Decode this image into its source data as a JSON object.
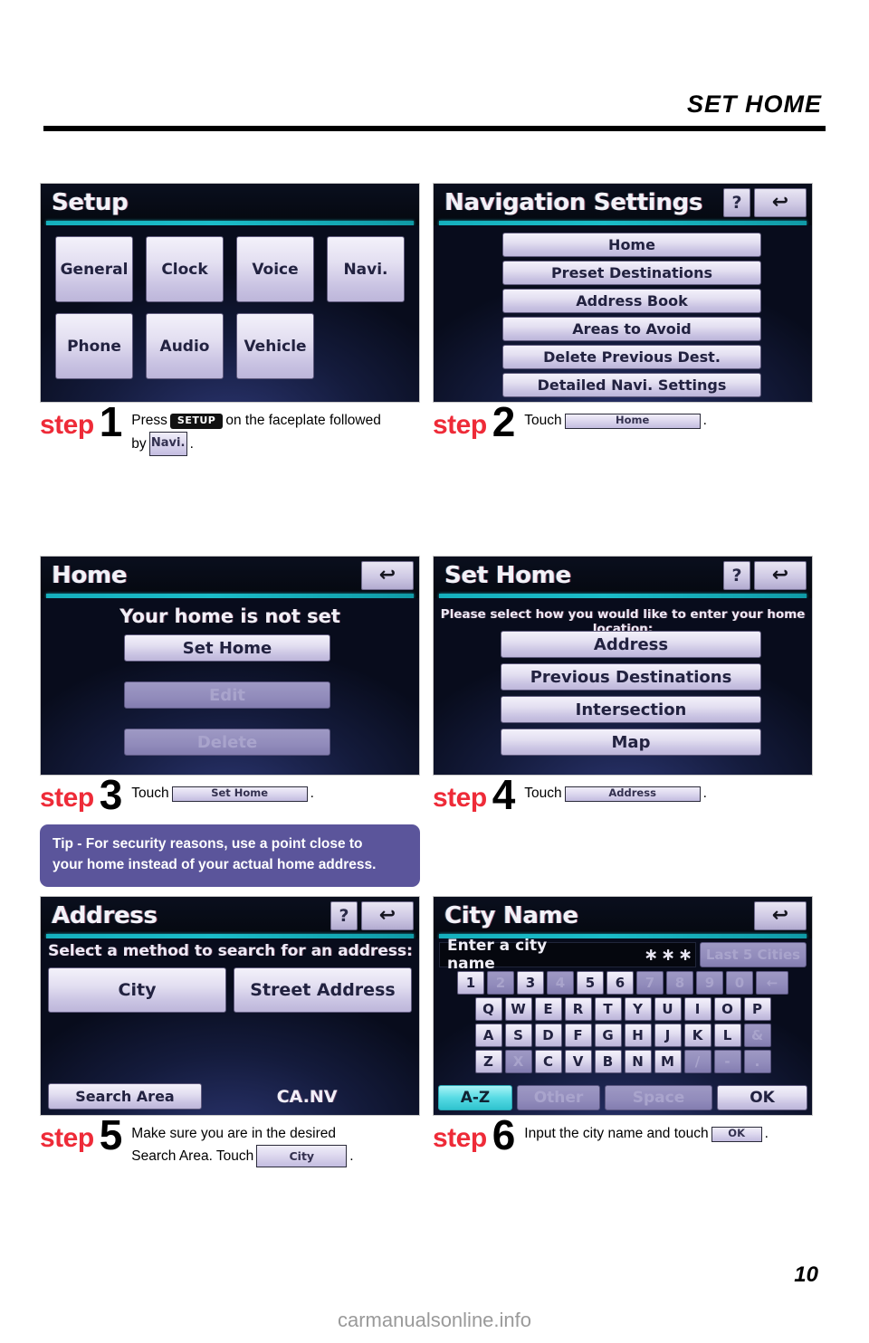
{
  "header": {
    "title": "SET HOME"
  },
  "footer": {
    "page_number": "10",
    "watermark": "carmanualsonline.info"
  },
  "tip": {
    "line1": "Tip - For security reasons, use a point close to",
    "line2": "your home instead of your actual home address."
  },
  "screens": {
    "setup": {
      "title": "Setup",
      "row1": [
        "General",
        "Clock",
        "Voice",
        "Navi."
      ],
      "row2": [
        "Phone",
        "Audio",
        "Vehicle"
      ]
    },
    "navigation_settings": {
      "title": "Navigation Settings",
      "help_label": "?",
      "back_label": "↩",
      "items": [
        "Home",
        "Preset Destinations",
        "Address Book",
        "Areas to Avoid",
        "Delete Previous Dest.",
        "Detailed Navi. Settings"
      ]
    },
    "home": {
      "title": "Home",
      "back_label": "↩",
      "message": "Your home is not set",
      "buttons": [
        {
          "label": "Set Home",
          "enabled": true
        },
        {
          "label": "Edit",
          "enabled": false
        },
        {
          "label": "Delete",
          "enabled": false
        }
      ]
    },
    "set_home": {
      "title": "Set Home",
      "help_label": "?",
      "back_label": "↩",
      "prompt": "Please select how you would like to enter your home location:",
      "items": [
        "Address",
        "Previous Destinations",
        "Intersection",
        "Map"
      ]
    },
    "address": {
      "title": "Address",
      "help_label": "?",
      "back_label": "↩",
      "prompt": "Select a method to search for an address:",
      "methods": [
        "City",
        "Street Address"
      ],
      "search_area_label": "Search Area",
      "search_area_value": "CA.NV"
    },
    "city_name": {
      "title": "City Name",
      "back_label": "↩",
      "input_placeholder": "Enter a city name",
      "input_stars": "∗∗∗",
      "last5_label": "Last 5 Cities",
      "rows": [
        [
          {
            "k": "1",
            "on": true
          },
          {
            "k": "2",
            "on": false
          },
          {
            "k": "3",
            "on": true
          },
          {
            "k": "4",
            "on": false
          },
          {
            "k": "5",
            "on": true
          },
          {
            "k": "6",
            "on": true
          },
          {
            "k": "7",
            "on": false
          },
          {
            "k": "8",
            "on": false
          },
          {
            "k": "9",
            "on": false
          },
          {
            "k": "0",
            "on": false
          },
          {
            "k": "←",
            "on": false,
            "wide": true
          }
        ],
        [
          {
            "k": "Q",
            "on": true
          },
          {
            "k": "W",
            "on": true
          },
          {
            "k": "E",
            "on": true
          },
          {
            "k": "R",
            "on": true
          },
          {
            "k": "T",
            "on": true
          },
          {
            "k": "Y",
            "on": true
          },
          {
            "k": "U",
            "on": true
          },
          {
            "k": "I",
            "on": true
          },
          {
            "k": "O",
            "on": true
          },
          {
            "k": "P",
            "on": true
          }
        ],
        [
          {
            "k": "A",
            "on": true
          },
          {
            "k": "S",
            "on": true
          },
          {
            "k": "D",
            "on": true
          },
          {
            "k": "F",
            "on": true
          },
          {
            "k": "G",
            "on": true
          },
          {
            "k": "H",
            "on": true
          },
          {
            "k": "J",
            "on": true
          },
          {
            "k": "K",
            "on": true
          },
          {
            "k": "L",
            "on": true
          },
          {
            "k": "&",
            "on": false
          }
        ],
        [
          {
            "k": "Z",
            "on": true
          },
          {
            "k": "X",
            "on": false
          },
          {
            "k": "C",
            "on": true
          },
          {
            "k": "V",
            "on": true
          },
          {
            "k": "B",
            "on": true
          },
          {
            "k": "N",
            "on": true
          },
          {
            "k": "M",
            "on": true
          },
          {
            "k": "/",
            "on": false
          },
          {
            "k": "-",
            "on": false
          },
          {
            "k": ".",
            "on": false
          }
        ]
      ],
      "bottom": {
        "az_label": "A-Z",
        "other_label": "Other",
        "space_label": "Space",
        "ok_label": "OK"
      }
    }
  },
  "steps": {
    "word": "step",
    "s1": {
      "num": "1",
      "t1a": "Press",
      "chip_setup": "SETUP",
      "t1b": "on the faceplate followed",
      "t1c": "by",
      "chip_navi": "Navi.",
      "t1d": "."
    },
    "s2": {
      "num": "2",
      "t1a": "Touch",
      "chip": "Home",
      "t1b": "."
    },
    "s3": {
      "num": "3",
      "t1a": "Touch",
      "chip": "Set Home",
      "t1b": "."
    },
    "s4": {
      "num": "4",
      "t1a": "Touch",
      "chip": "Address",
      "t1b": "."
    },
    "s5": {
      "num": "5",
      "line1": "Make sure you are in the desired",
      "t2a": "Search Area. Touch",
      "chip": "City",
      "t2b": "."
    },
    "s6": {
      "num": "6",
      "t1a": "Input the city name and touch",
      "chip": "OK",
      "t1b": "."
    }
  }
}
